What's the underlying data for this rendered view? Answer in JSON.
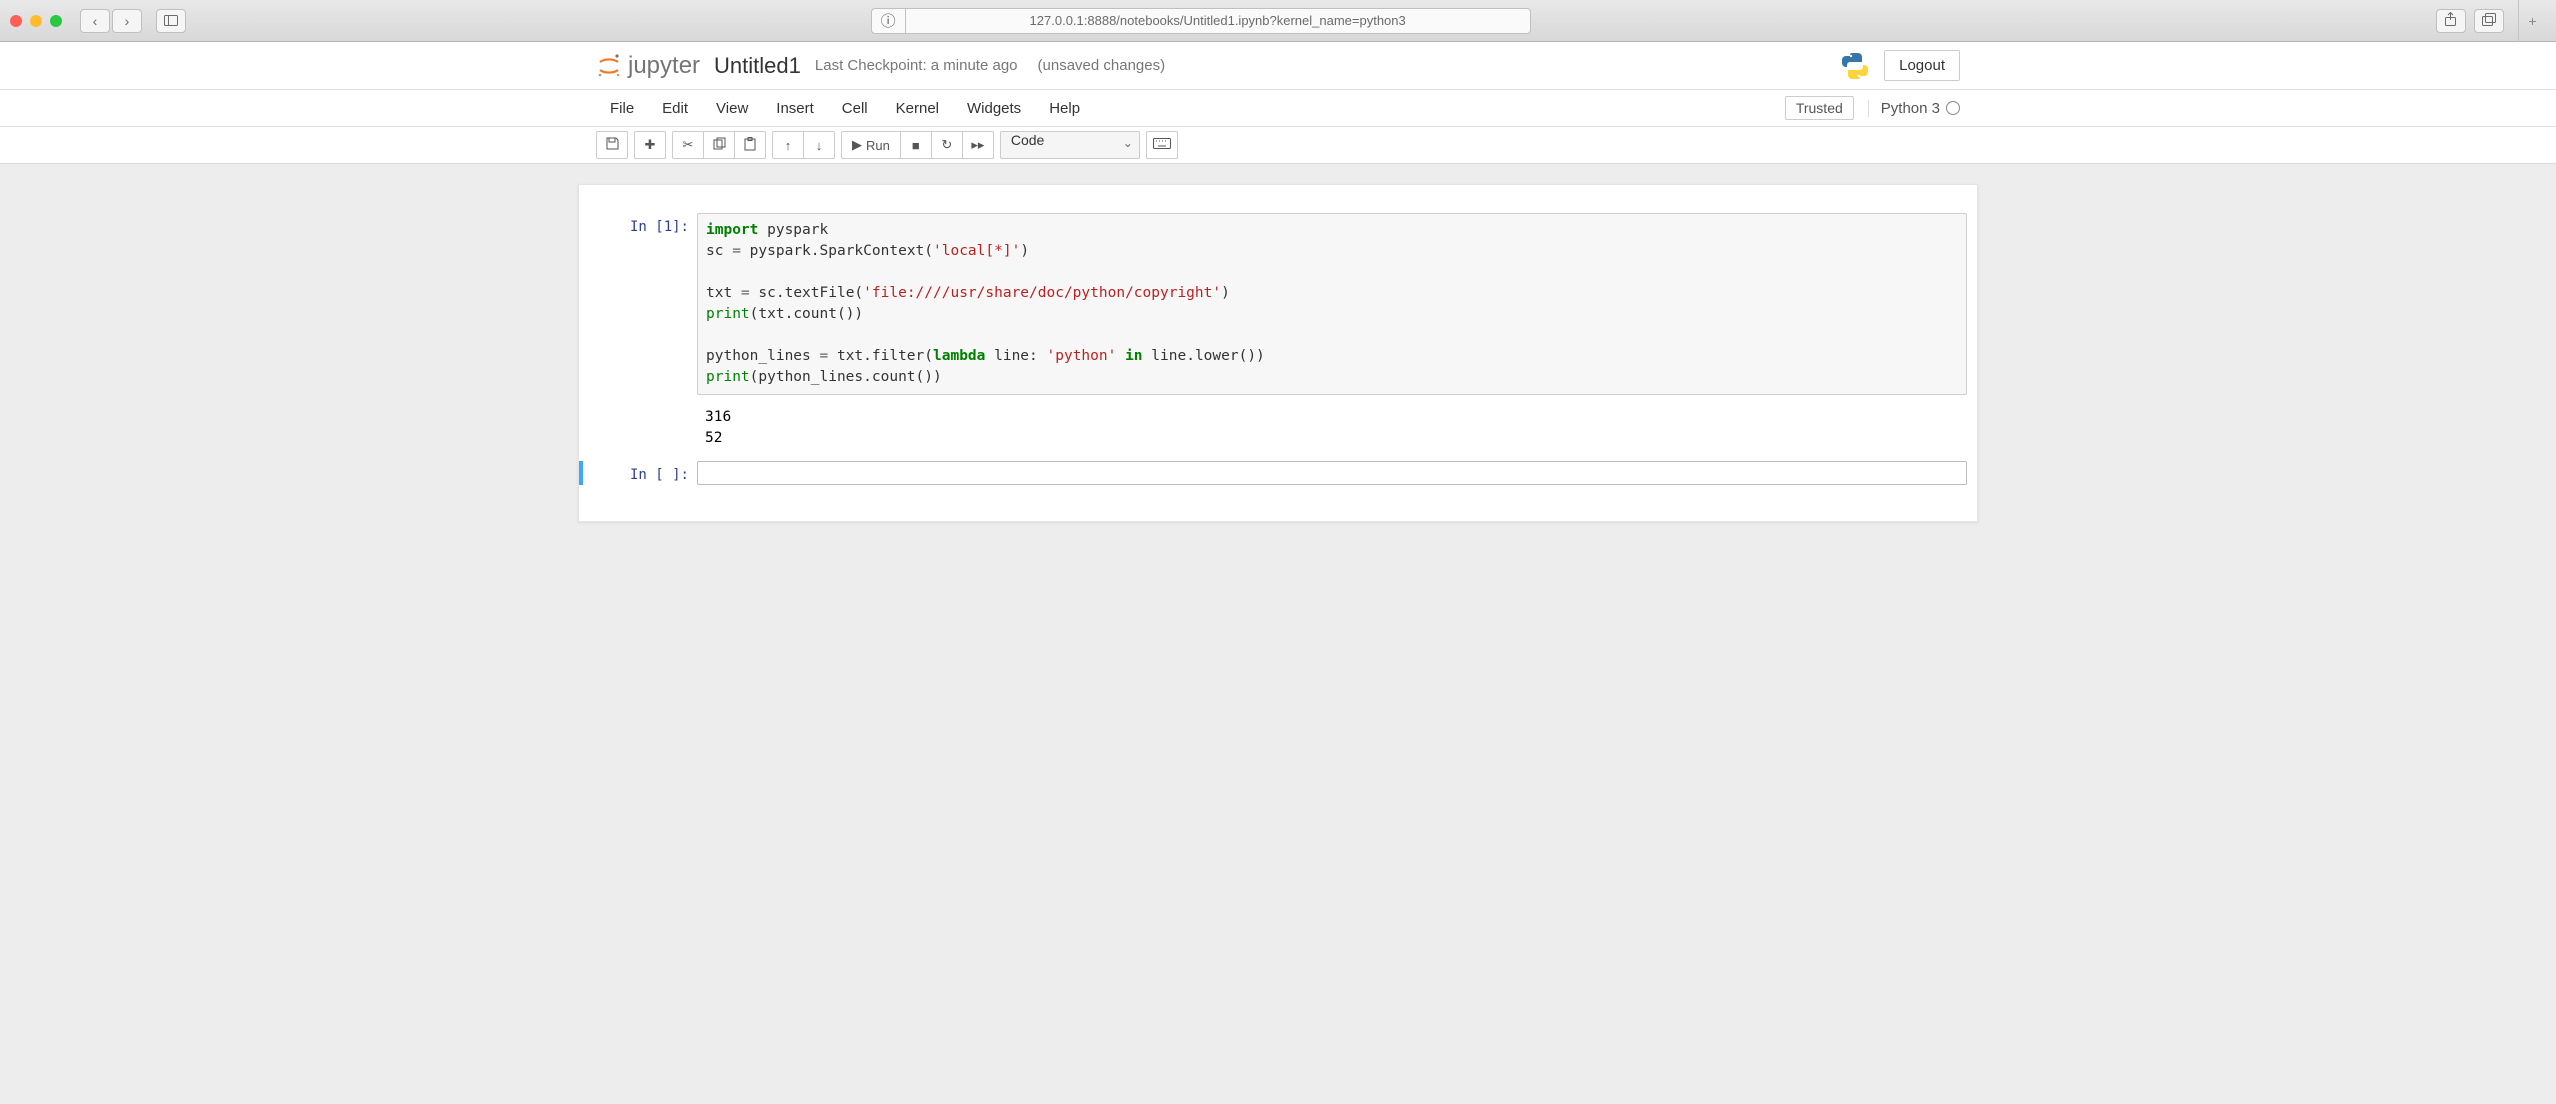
{
  "browser": {
    "url": "127.0.0.1:8888/notebooks/Untitled1.ipynb?kernel_name=python3"
  },
  "header": {
    "brand": "jupyter",
    "title": "Untitled1",
    "checkpoint": "Last Checkpoint: a minute ago",
    "unsaved": "(unsaved changes)",
    "logout_label": "Logout"
  },
  "menubar": {
    "items": [
      "File",
      "Edit",
      "View",
      "Insert",
      "Cell",
      "Kernel",
      "Widgets",
      "Help"
    ],
    "trusted_label": "Trusted",
    "kernel_label": "Python 3"
  },
  "toolbar": {
    "run_label": "Run",
    "cell_type": "Code"
  },
  "cells": [
    {
      "prompt": "In [1]:",
      "code_tokens": [
        {
          "t": "import",
          "c": "k-kw"
        },
        {
          "t": " pyspark\n"
        },
        {
          "t": "sc "
        },
        {
          "t": "=",
          "c": "k-op"
        },
        {
          "t": " pyspark"
        },
        {
          "t": "."
        },
        {
          "t": "SparkContext("
        },
        {
          "t": "'local[*]'",
          "c": "k-str"
        },
        {
          "t": ")\n\n"
        },
        {
          "t": "txt "
        },
        {
          "t": "=",
          "c": "k-op"
        },
        {
          "t": " sc"
        },
        {
          "t": "."
        },
        {
          "t": "textFile("
        },
        {
          "t": "'file:////usr/share/doc/python/copyright'",
          "c": "k-str"
        },
        {
          "t": ")\n"
        },
        {
          "t": "print",
          "c": "k-builtin"
        },
        {
          "t": "(txt"
        },
        {
          "t": "."
        },
        {
          "t": "count())\n\n"
        },
        {
          "t": "python_lines "
        },
        {
          "t": "=",
          "c": "k-op"
        },
        {
          "t": " txt"
        },
        {
          "t": "."
        },
        {
          "t": "filter("
        },
        {
          "t": "lambda",
          "c": "k-kw"
        },
        {
          "t": " line: "
        },
        {
          "t": "'python'",
          "c": "k-str"
        },
        {
          "t": " "
        },
        {
          "t": "in",
          "c": "k-kw"
        },
        {
          "t": " line"
        },
        {
          "t": "."
        },
        {
          "t": "lower())\n"
        },
        {
          "t": "print",
          "c": "k-builtin"
        },
        {
          "t": "(python_lines"
        },
        {
          "t": "."
        },
        {
          "t": "count())"
        }
      ],
      "output": "316\n52"
    },
    {
      "prompt": "In [ ]:",
      "code_tokens": [],
      "output": null,
      "selected": true
    }
  ]
}
